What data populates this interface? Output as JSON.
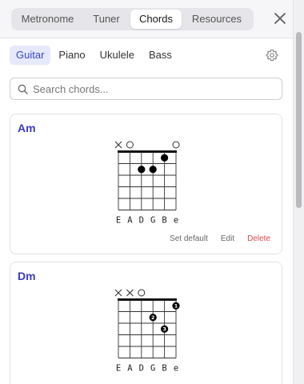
{
  "header": {
    "tabs": [
      {
        "label": "Metronome",
        "active": false
      },
      {
        "label": "Tuner",
        "active": false
      },
      {
        "label": "Chords",
        "active": true
      },
      {
        "label": "Resources",
        "active": false
      }
    ],
    "close_icon": "close-icon"
  },
  "instruments": {
    "tabs": [
      {
        "label": "Guitar",
        "active": true
      },
      {
        "label": "Piano",
        "active": false
      },
      {
        "label": "Ukulele",
        "active": false
      },
      {
        "label": "Bass",
        "active": false
      }
    ],
    "settings_icon": "gear-icon"
  },
  "search": {
    "placeholder": "Search chords..."
  },
  "actions": {
    "set_default": "Set default",
    "edit": "Edit",
    "delete": "Delete"
  },
  "chords": [
    {
      "name": "Am",
      "strings": [
        "E",
        "A",
        "D",
        "G",
        "B",
        "e"
      ],
      "markers": [
        "x",
        "o",
        "",
        "",
        "",
        "o"
      ],
      "dots": [
        {
          "string": 4,
          "fret": 1,
          "finger": ""
        },
        {
          "string": 2,
          "fret": 2,
          "finger": ""
        },
        {
          "string": 3,
          "fret": 2,
          "finger": ""
        }
      ]
    },
    {
      "name": "Dm",
      "strings": [
        "E",
        "A",
        "D",
        "G",
        "B",
        "e"
      ],
      "markers": [
        "x",
        "x",
        "o",
        "",
        "",
        ""
      ],
      "dots": [
        {
          "string": 5,
          "fret": 1,
          "finger": "1"
        },
        {
          "string": 3,
          "fret": 2,
          "finger": "2"
        },
        {
          "string": 4,
          "fret": 3,
          "finger": "3"
        }
      ]
    }
  ],
  "colors": {
    "accent": "#3a3ac4",
    "delete": "#e04848",
    "active_tab_bg": "#e6e9fb"
  }
}
